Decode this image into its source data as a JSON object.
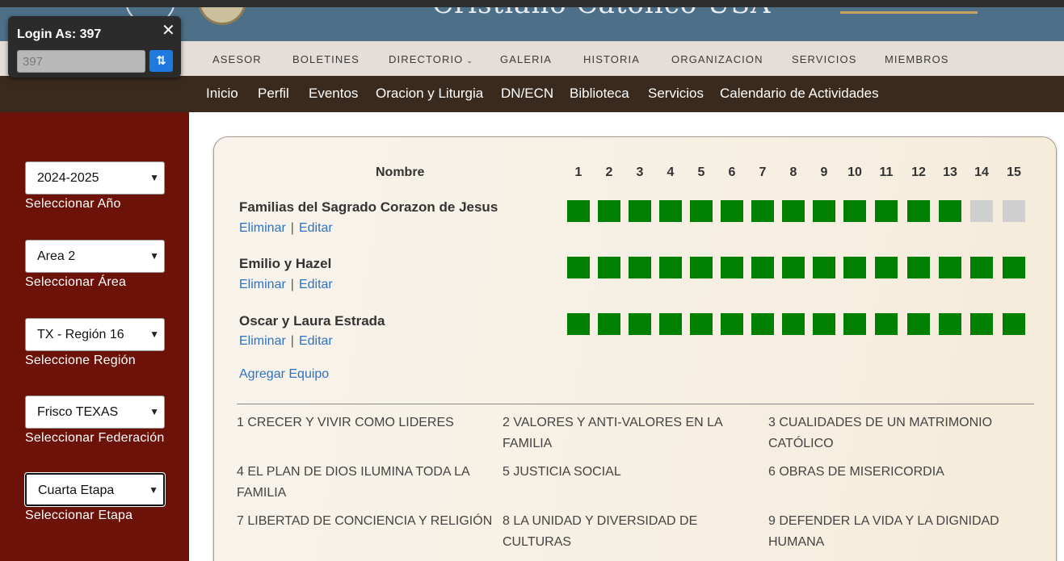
{
  "header": {
    "title": "Cristiano Católico USA"
  },
  "login": {
    "title": "Login As: 397",
    "input_value": "397",
    "close_icon": "✕",
    "switch_icon": "⇅"
  },
  "nav_top": {
    "items": [
      "ASESOR",
      "BOLETINES",
      "DIRECTORIO",
      "GALERIA",
      "HISTORIA",
      "ORGANIZACION",
      "SERVICIOS",
      "MIEMBROS"
    ],
    "caret": "⌄"
  },
  "nav_main": {
    "items": [
      "Inicio",
      "Perfil",
      "Eventos",
      "Oracion y Liturgia",
      "DN/ECN",
      "Biblioteca",
      "Servicios",
      "Calendario de Actividades"
    ]
  },
  "sidebar": {
    "selects": [
      {
        "value": "2024-2025",
        "label": "Seleccionar Año"
      },
      {
        "value": "Area 2",
        "label": "Seleccionar Área"
      },
      {
        "value": "TX - Región 16",
        "label": "Seleccione Región"
      },
      {
        "value": "Frisco TEXAS",
        "label": "Seleccionar Federación"
      },
      {
        "value": "Cuarta Etapa",
        "label": "Seleccionar Etapa"
      }
    ]
  },
  "table": {
    "header_name": "Nombre",
    "columns": [
      "1",
      "2",
      "3",
      "4",
      "5",
      "6",
      "7",
      "8",
      "9",
      "10",
      "11",
      "12",
      "13",
      "14",
      "15"
    ],
    "delete_label": "Eliminar",
    "separator": "|",
    "edit_label": "Editar",
    "teams": [
      {
        "name": "Familias del Sagrado Corazon de Jesus",
        "completed": [
          1,
          1,
          1,
          1,
          1,
          1,
          1,
          1,
          1,
          1,
          1,
          1,
          1,
          0,
          0
        ]
      },
      {
        "name": "Emilio y Hazel",
        "completed": [
          1,
          1,
          1,
          1,
          1,
          1,
          1,
          1,
          1,
          1,
          1,
          1,
          1,
          1,
          1
        ]
      },
      {
        "name": "Oscar y Laura Estrada",
        "completed": [
          1,
          1,
          1,
          1,
          1,
          1,
          1,
          1,
          1,
          1,
          1,
          1,
          1,
          1,
          1
        ]
      }
    ],
    "add_team_label": "Agregar Equipo"
  },
  "topics": [
    "1 CRECER Y VIVIR COMO LIDERES",
    "2 VALORES Y ANTI-VALORES EN LA FAMILIA",
    "3 CUALIDADES DE UN MATRIMONIO CATÓLICO",
    "4 EL PLAN DE DIOS ILUMINA TODA LA FAMILIA",
    "5 JUSTICIA SOCIAL",
    "6 OBRAS DE MISERICORDIA",
    "7 LIBERTAD DE CONCIENCIA Y RELIGIÓN",
    "8 LA UNIDAD Y DIVERSIDAD DE CULTURAS",
    "9 DEFENDER LA VIDA Y LA DIGNIDAD HUMANA"
  ],
  "colors": {
    "completed": "#008000",
    "pending": "#cfcfcf",
    "sidebar": "#6d1209",
    "link": "#2f72c0"
  }
}
